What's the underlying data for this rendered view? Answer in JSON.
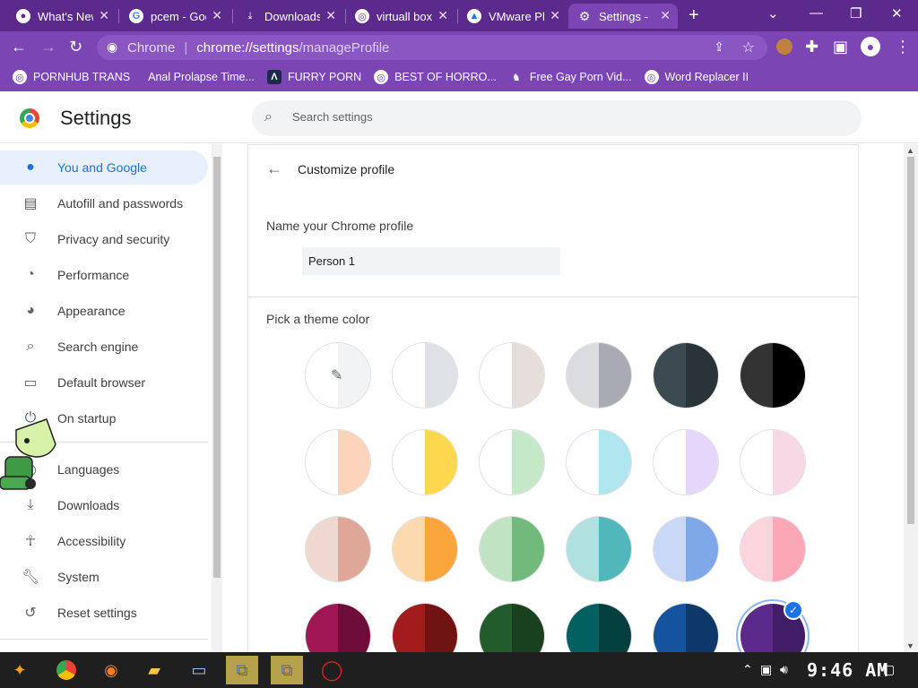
{
  "tabs": [
    {
      "title": "What's New",
      "favicon": "github-icon"
    },
    {
      "title": "pcem - Google",
      "favicon": "google-icon"
    },
    {
      "title": "Downloads",
      "favicon": "download-icon"
    },
    {
      "title": "virtuall box",
      "favicon": "globe-icon"
    },
    {
      "title": "VMware Pl",
      "favicon": "vmware-icon"
    },
    {
      "title": "Settings -",
      "favicon": "gear-icon",
      "active": true
    }
  ],
  "omnibox": {
    "origin_label": "Chrome",
    "host": "chrome://settings",
    "path": "/manageProfile"
  },
  "bookmarks": [
    "PORNHUB TRANS",
    "Anal Prolapse Time...",
    "FURRY PORN",
    "BEST OF HORRO...",
    "Free Gay Porn Vid...",
    "Word Replacer II"
  ],
  "settings": {
    "title": "Settings",
    "search_placeholder": "Search settings"
  },
  "sidebar": {
    "items": [
      {
        "label": "You and Google",
        "icon": "person-icon",
        "active": true
      },
      {
        "label": "Autofill and passwords",
        "icon": "clipboard-icon"
      },
      {
        "label": "Privacy and security",
        "icon": "shield-icon"
      },
      {
        "label": "Performance",
        "icon": "speedometer-icon"
      },
      {
        "label": "Appearance",
        "icon": "palette-icon"
      },
      {
        "label": "Search engine",
        "icon": "search-icon"
      },
      {
        "label": "Default browser",
        "icon": "browser-icon"
      },
      {
        "label": "On startup",
        "icon": "power-icon"
      },
      {
        "label": "Languages",
        "icon": "globe-icon"
      },
      {
        "label": "Downloads",
        "icon": "download-icon"
      },
      {
        "label": "Accessibility",
        "icon": "accessibility-icon"
      },
      {
        "label": "System",
        "icon": "wrench-icon"
      },
      {
        "label": "Reset settings",
        "icon": "history-icon"
      }
    ]
  },
  "profile": {
    "card_title": "Customize profile",
    "name_label": "Name your Chrome profile",
    "name_value": "Person 1",
    "theme_label": "Pick a theme color",
    "swatches": [
      {
        "left": "#ffffff",
        "right": "#f1f3f4",
        "custom": true
      },
      {
        "left": "#ffffff",
        "right": "#dee1e6"
      },
      {
        "left": "#ffffff",
        "right": "#e6deda"
      },
      {
        "left": "#dadce0",
        "right": "#a8abb3"
      },
      {
        "left": "#3c4a52",
        "right": "#2a3338"
      },
      {
        "left": "#333333",
        "right": "#000000"
      },
      {
        "left": "#ffffff",
        "right": "#fcd4bc"
      },
      {
        "left": "#ffffff",
        "right": "#fdd84f"
      },
      {
        "left": "#ffffff",
        "right": "#c5e8c8"
      },
      {
        "left": "#ffffff",
        "right": "#b0e6f0"
      },
      {
        "left": "#ffffff",
        "right": "#e5d6fb"
      },
      {
        "left": "#ffffff",
        "right": "#f8d8e4"
      },
      {
        "left": "#efd8cf",
        "right": "#dea797"
      },
      {
        "left": "#fdd9b0",
        "right": "#fba63c"
      },
      {
        "left": "#c2e2c4",
        "right": "#72ba7c"
      },
      {
        "left": "#b1e0e0",
        "right": "#52b7ba"
      },
      {
        "left": "#c9d8f6",
        "right": "#7fa8e8"
      },
      {
        "left": "#fcd4dc",
        "right": "#fba7b5"
      },
      {
        "left": "#a01654",
        "right": "#6e0d39"
      },
      {
        "left": "#a21c1c",
        "right": "#701313"
      },
      {
        "left": "#225c2c",
        "right": "#19401f"
      },
      {
        "left": "#036060",
        "right": "#033f3f"
      },
      {
        "left": "#15539e",
        "right": "#0f386a"
      },
      {
        "left": "#5b2a8c",
        "right": "#431e68",
        "selected": true
      }
    ]
  },
  "taskbar": {
    "apps": [
      "start-icon",
      "chrome-icon",
      "firefox-icon",
      "folder-icon",
      "monitor-icon",
      "network-icon",
      "network-icon",
      "opera-icon"
    ],
    "clock": "9:46 AM"
  },
  "colors": {
    "frame": "#5b2a8c",
    "toolbar": "#7b46b4",
    "accent": "#1a73e8"
  }
}
